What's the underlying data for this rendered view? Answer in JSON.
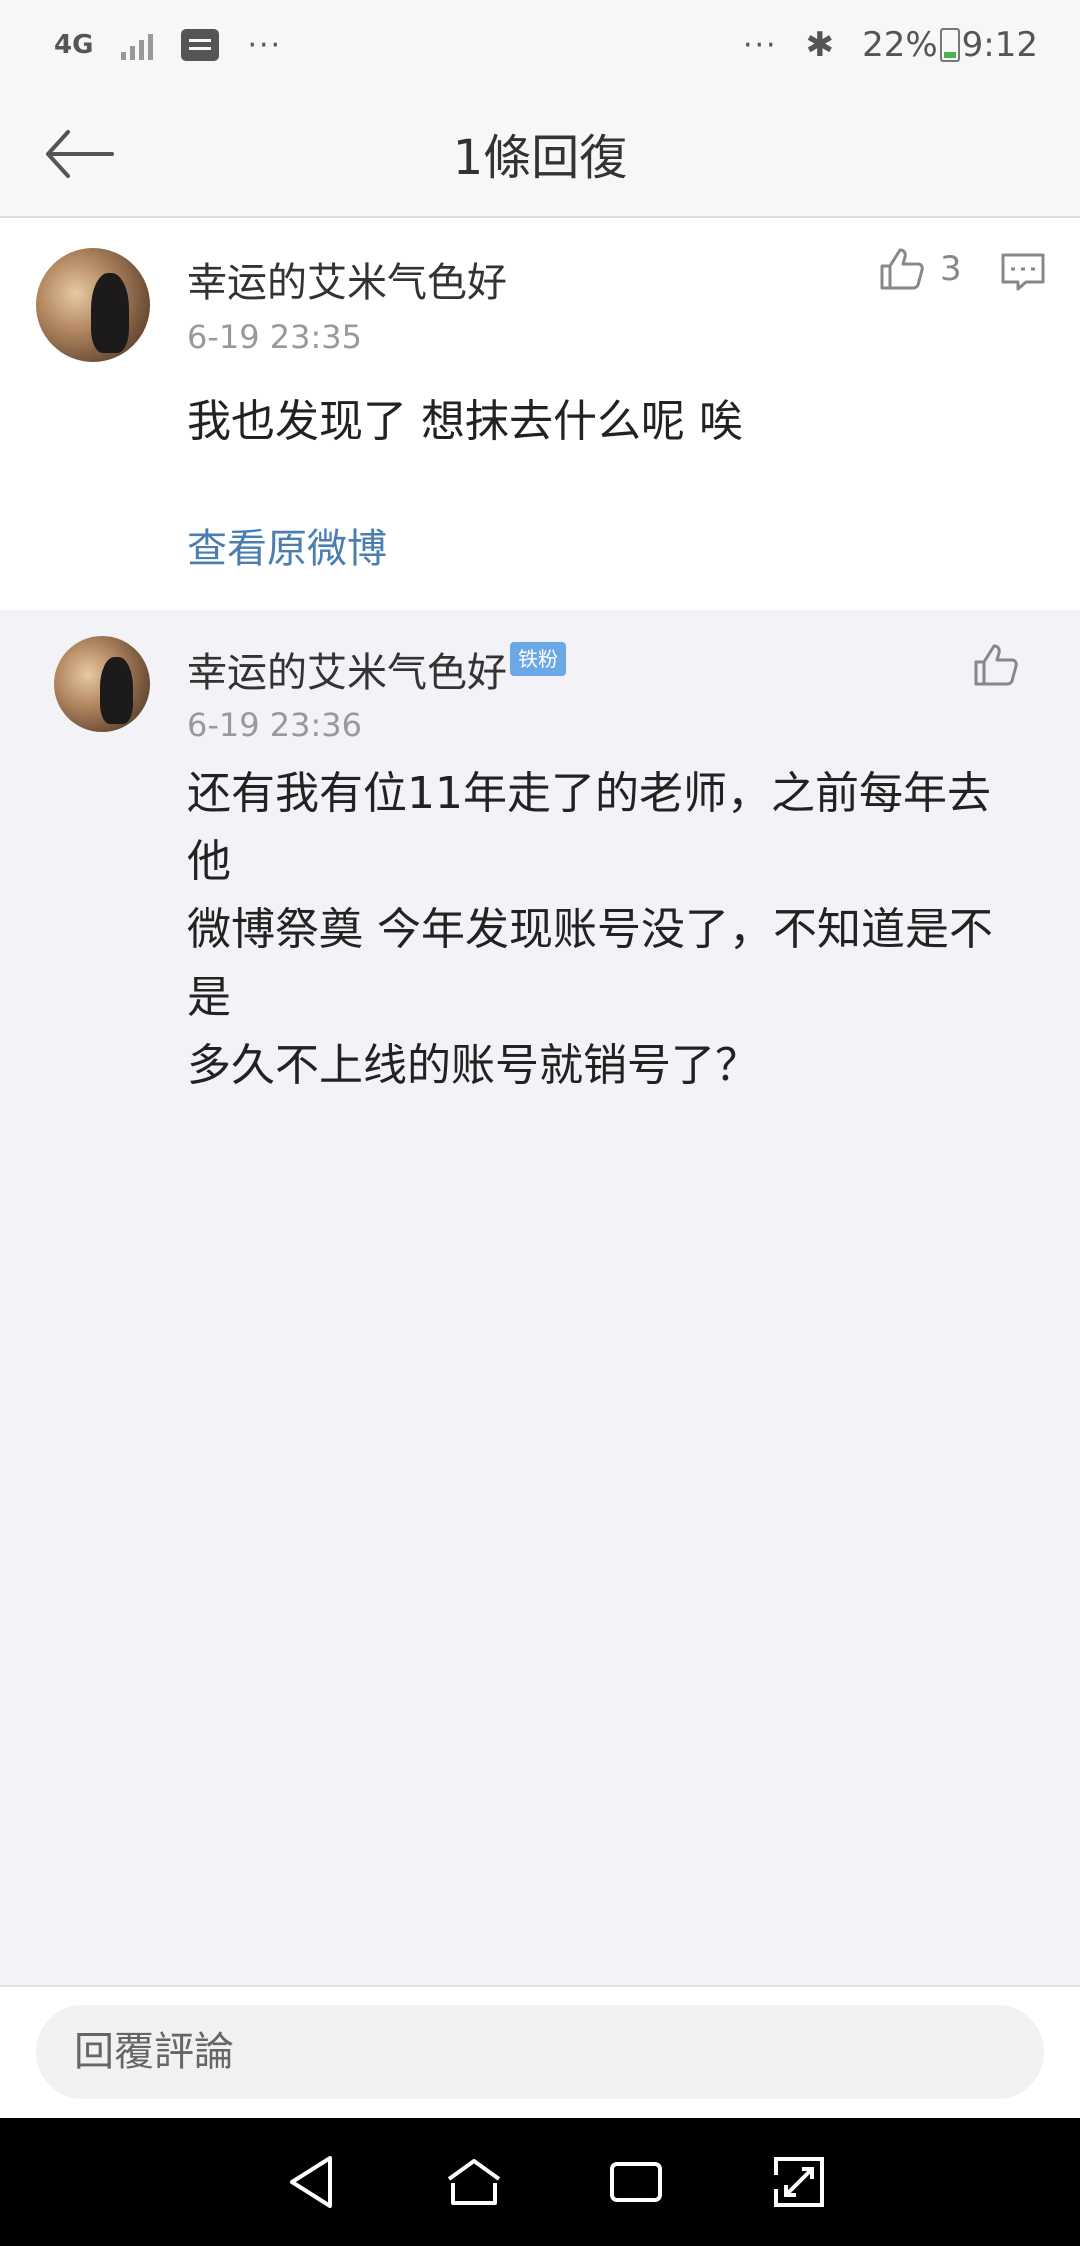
{
  "status_bar": {
    "network": "4G",
    "battery": "22%",
    "time": "9:12",
    "overflow_dots": "···"
  },
  "nav": {
    "title": "1條回復"
  },
  "main_comment": {
    "username": "幸运的艾米气色好",
    "timestamp": "6-19 23:35",
    "content": "我也发现了 想抹去什么呢 唉",
    "like_count": "3",
    "view_original": "查看原微博"
  },
  "reply": {
    "username": "幸运的艾米气色好",
    "badge": "铁粉",
    "timestamp": "6-19 23:36",
    "content_lines": [
      "还有我有位11年走了的老师，之前每年去他",
      "微博祭奠 今年发现账号没了，不知道是不是",
      "多久不上线的账号就销号了？"
    ]
  },
  "bottom": {
    "input_placeholder": "回覆評論"
  },
  "colors": {
    "link": "#4a7db0",
    "badge": "#6aa8e8",
    "page_bg": "#f2f2f7"
  }
}
